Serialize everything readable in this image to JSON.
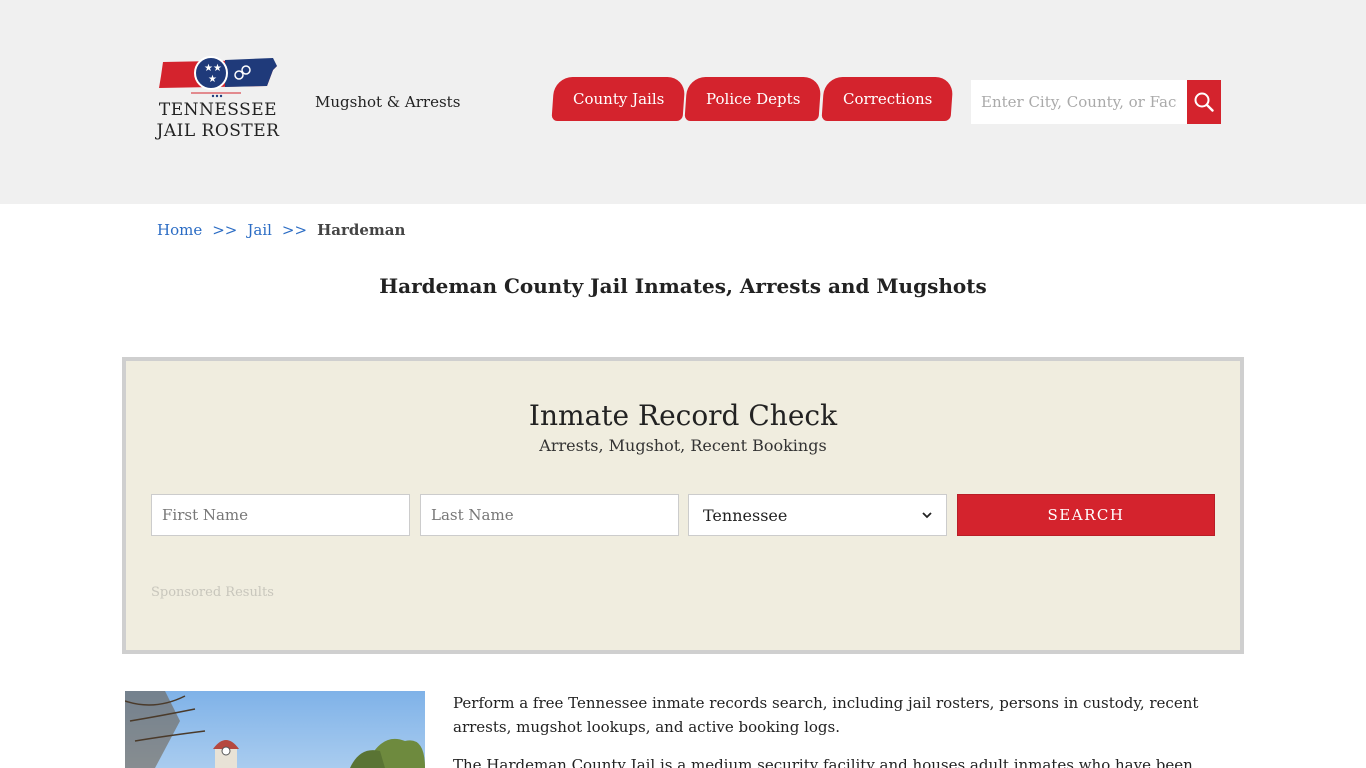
{
  "header": {
    "logo": {
      "line1": "TENNESSEE",
      "line2": "JAIL ROSTER",
      "icon": "tennessee-state-flag-logo"
    },
    "tagline": "Mugshot & Arrests",
    "nav": [
      {
        "label": "County Jails"
      },
      {
        "label": "Police Depts"
      },
      {
        "label": "Corrections"
      }
    ],
    "search": {
      "placeholder": "Enter City, County, or Facility",
      "icon": "search-icon"
    }
  },
  "breadcrumb": {
    "home": "Home",
    "separator": ">>",
    "jail": "Jail",
    "current": "Hardeman"
  },
  "page_title": "Hardeman County Jail Inmates, Arrests and Mugshots",
  "record_check": {
    "title": "Inmate Record Check",
    "subtitle": "Arrests, Mugshot, Recent Bookings",
    "first_name_placeholder": "First Name",
    "last_name_placeholder": "Last Name",
    "state_selected": "Tennessee",
    "search_label": "SEARCH",
    "sponsored": "Sponsored Results"
  },
  "content": {
    "paragraph1": "Perform a free Tennessee inmate records search, including jail rosters, persons in custody, recent arrests, mugshot lookups, and active booking logs.",
    "paragraph2": "The Hardeman County Jail is a medium security facility and houses adult inmates who have been"
  },
  "colors": {
    "accent_red": "#d4232d",
    "header_bg": "#f0f0f0",
    "record_bg": "#f0eddf",
    "link_blue": "#2b6cc4"
  }
}
